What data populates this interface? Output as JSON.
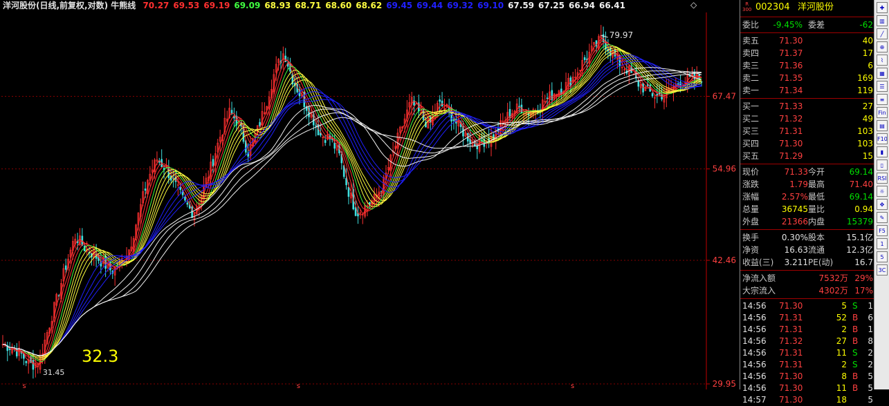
{
  "chart_header": {
    "title": "洋河股份(日线,前复权,对数) 牛熊线",
    "ma_values": [
      {
        "text": "70.27",
        "color": "#ff3030"
      },
      {
        "text": "69.53",
        "color": "#ff3030"
      },
      {
        "text": "69.19",
        "color": "#ff3030"
      },
      {
        "text": "69.09",
        "color": "#40ff40"
      },
      {
        "text": "68.93",
        "color": "#ffff40"
      },
      {
        "text": "68.71",
        "color": "#ffff40"
      },
      {
        "text": "68.60",
        "color": "#ffff40"
      },
      {
        "text": "68.62",
        "color": "#ffff40"
      },
      {
        "text": "69.45",
        "color": "#2020ff"
      },
      {
        "text": "69.44",
        "color": "#2020ff"
      },
      {
        "text": "69.32",
        "color": "#2020ff"
      },
      {
        "text": "69.10",
        "color": "#2020ff"
      },
      {
        "text": "67.59",
        "color": "#f0f0f0"
      },
      {
        "text": "67.25",
        "color": "#f0f0f0"
      },
      {
        "text": "66.94",
        "color": "#f0f0f0"
      },
      {
        "text": "66.41",
        "color": "#f0f0f0"
      }
    ],
    "diamond_glyph": "◇"
  },
  "chart_data": {
    "type": "line",
    "title": "洋河股份(日线,前复权,对数) 牛熊线",
    "yscale": "log",
    "ylim": [
      29.95,
      85.5
    ],
    "y_ticks": [
      67.47,
      54.96,
      42.46,
      29.95
    ],
    "y_tick_labels": [
      "67.47",
      "54.96",
      "42.46",
      "29.95"
    ],
    "annotations": [
      {
        "text": "79.97",
        "kind": "high"
      },
      {
        "text": "31.45",
        "kind": "low"
      },
      {
        "text": "32.3",
        "kind": "note"
      }
    ],
    "bottom_markers": [
      "s",
      "s",
      "s"
    ],
    "grid": "horizontal dashed",
    "series": [
      {
        "name": "price",
        "color": "#ff3030",
        "values": [
          33.5,
          33.2,
          32.6,
          31.6,
          31.8,
          35,
          38.2,
          42,
          45.5,
          44,
          43.2,
          42.2,
          41.2,
          42.2,
          44,
          48.5,
          53.5,
          56.5,
          55,
          52.5,
          50,
          48.5,
          51.5,
          55.5,
          60.5,
          64.5,
          62.5,
          57.5,
          61,
          66,
          72.5,
          76.5,
          70.5,
          67,
          64,
          60.5,
          60,
          57.5,
          52,
          48.5,
          49.5,
          50.5,
          53,
          57.5,
          62,
          66.5,
          64,
          62,
          66,
          65,
          62.5,
          60.5,
          59,
          59.5,
          60,
          62.5,
          64.5,
          65.5,
          64.5,
          65.5,
          67,
          68.5,
          69.5,
          71.5,
          74.5,
          77,
          79.5,
          76.5,
          74,
          72.5,
          70,
          68.5,
          67.5,
          68,
          69.5,
          70.5,
          70.8,
          71.3
        ]
      },
      {
        "name": "ma-fast",
        "color": "#ff3030"
      },
      {
        "name": "ma-mid",
        "color": "#ffff40"
      },
      {
        "name": "ma-slow",
        "color": "#2020ff"
      },
      {
        "name": "ma-long",
        "color": "#f0f0f0"
      }
    ]
  },
  "quote": {
    "badge_top": "R",
    "badge_bottom": "300",
    "code": "002304",
    "name": "洋河股份",
    "weibi_label": "委比",
    "weibi_value": "-9.45%",
    "weicha_label": "委差",
    "weicha_value": "-62",
    "asks": [
      {
        "label": "卖五",
        "price": "71.30",
        "vol": "40"
      },
      {
        "label": "卖四",
        "price": "71.37",
        "vol": "17"
      },
      {
        "label": "卖三",
        "price": "71.36",
        "vol": "6"
      },
      {
        "label": "卖二",
        "price": "71.35",
        "vol": "169"
      },
      {
        "label": "卖一",
        "price": "71.34",
        "vol": "119"
      }
    ],
    "bids": [
      {
        "label": "买一",
        "price": "71.33",
        "vol": "27"
      },
      {
        "label": "买二",
        "price": "71.32",
        "vol": "49"
      },
      {
        "label": "买三",
        "price": "71.31",
        "vol": "103"
      },
      {
        "label": "买四",
        "price": "71.30",
        "vol": "103"
      },
      {
        "label": "买五",
        "price": "71.29",
        "vol": "15"
      }
    ],
    "stats": [
      {
        "l1": "现价",
        "v1": "71.33",
        "c1": "red",
        "l2": "今开",
        "v2": "69.14",
        "c2": "green"
      },
      {
        "l1": "涨跌",
        "v1": "1.79",
        "c1": "red",
        "l2": "最高",
        "v2": "71.40",
        "c2": "red"
      },
      {
        "l1": "涨幅",
        "v1": "2.57%",
        "c1": "red",
        "l2": "最低",
        "v2": "69.14",
        "c2": "green"
      },
      {
        "l1": "总量",
        "v1": "36745",
        "c1": "yel",
        "l2": "量比",
        "v2": "0.94",
        "c2": "yel"
      },
      {
        "l1": "外盘",
        "v1": "21366",
        "c1": "red",
        "l2": "内盘",
        "v2": "15379",
        "c2": "green"
      }
    ],
    "fund": [
      {
        "l1": "换手",
        "v1": "0.30%",
        "l2": "股本",
        "v2": "15.1亿"
      },
      {
        "l1": "净资",
        "v1": "16.63",
        "l2": "流通",
        "v2": "12.3亿"
      },
      {
        "l1": "收益(三)",
        "v1": "3.211",
        "l2": "PE(动)",
        "v2": "16.7"
      }
    ],
    "flows": [
      {
        "label": "净流入额",
        "value": "7532万",
        "pct": "29%"
      },
      {
        "label": "大宗流入",
        "value": "4302万",
        "pct": "17%"
      }
    ],
    "ticks": [
      {
        "time": "14:56",
        "price": "71.30",
        "vol": "5",
        "bs": "S",
        "n": "1"
      },
      {
        "time": "14:56",
        "price": "71.31",
        "vol": "52",
        "bs": "B",
        "n": "6"
      },
      {
        "time": "14:56",
        "price": "71.31",
        "vol": "2",
        "bs": "B",
        "n": "1"
      },
      {
        "time": "14:56",
        "price": "71.32",
        "vol": "27",
        "bs": "B",
        "n": "8"
      },
      {
        "time": "14:56",
        "price": "71.31",
        "vol": "11",
        "bs": "S",
        "n": "2"
      },
      {
        "time": "14:56",
        "price": "71.31",
        "vol": "2",
        "bs": "S",
        "n": "2"
      },
      {
        "time": "14:56",
        "price": "71.30",
        "vol": "8",
        "bs": "B",
        "n": "5"
      },
      {
        "time": "14:56",
        "price": "71.30",
        "vol": "11",
        "bs": "B",
        "n": "5"
      },
      {
        "time": "14:57",
        "price": "71.30",
        "vol": "18",
        "bs": "",
        "n": "5"
      }
    ]
  },
  "toolbar": {
    "buttons": [
      {
        "name": "crosshair-tool",
        "glyph": "✚"
      },
      {
        "name": "kline-tool",
        "glyph": "▥"
      },
      {
        "name": "line-tool",
        "glyph": "╱"
      },
      {
        "name": "zoom-tool",
        "glyph": "⊕"
      },
      {
        "name": "trend-tool",
        "glyph": "⌇"
      },
      {
        "name": "grid-tool",
        "glyph": "▦"
      },
      {
        "name": "table-tool",
        "glyph": "☰"
      },
      {
        "name": "list-tool",
        "glyph": "≡"
      },
      {
        "name": "fin-tool",
        "glyph": "Fin"
      },
      {
        "name": "doc-tool",
        "glyph": "▤"
      },
      {
        "name": "f10-tool",
        "glyph": "F10"
      },
      {
        "name": "signal-tool",
        "glyph": "▮"
      },
      {
        "name": "chart-tool",
        "glyph": "▯"
      },
      {
        "name": "rsi-tool",
        "glyph": "RSI"
      },
      {
        "name": "alarm-tool",
        "glyph": "☼"
      },
      {
        "name": "move-tool",
        "glyph": "✥"
      },
      {
        "name": "pen-tool",
        "glyph": "✎"
      },
      {
        "name": "fs-tool",
        "glyph": "F5"
      },
      {
        "name": "page-one",
        "glyph": "1"
      },
      {
        "name": "page-five",
        "glyph": "5"
      },
      {
        "name": "page-3c",
        "glyph": "3C"
      }
    ]
  }
}
